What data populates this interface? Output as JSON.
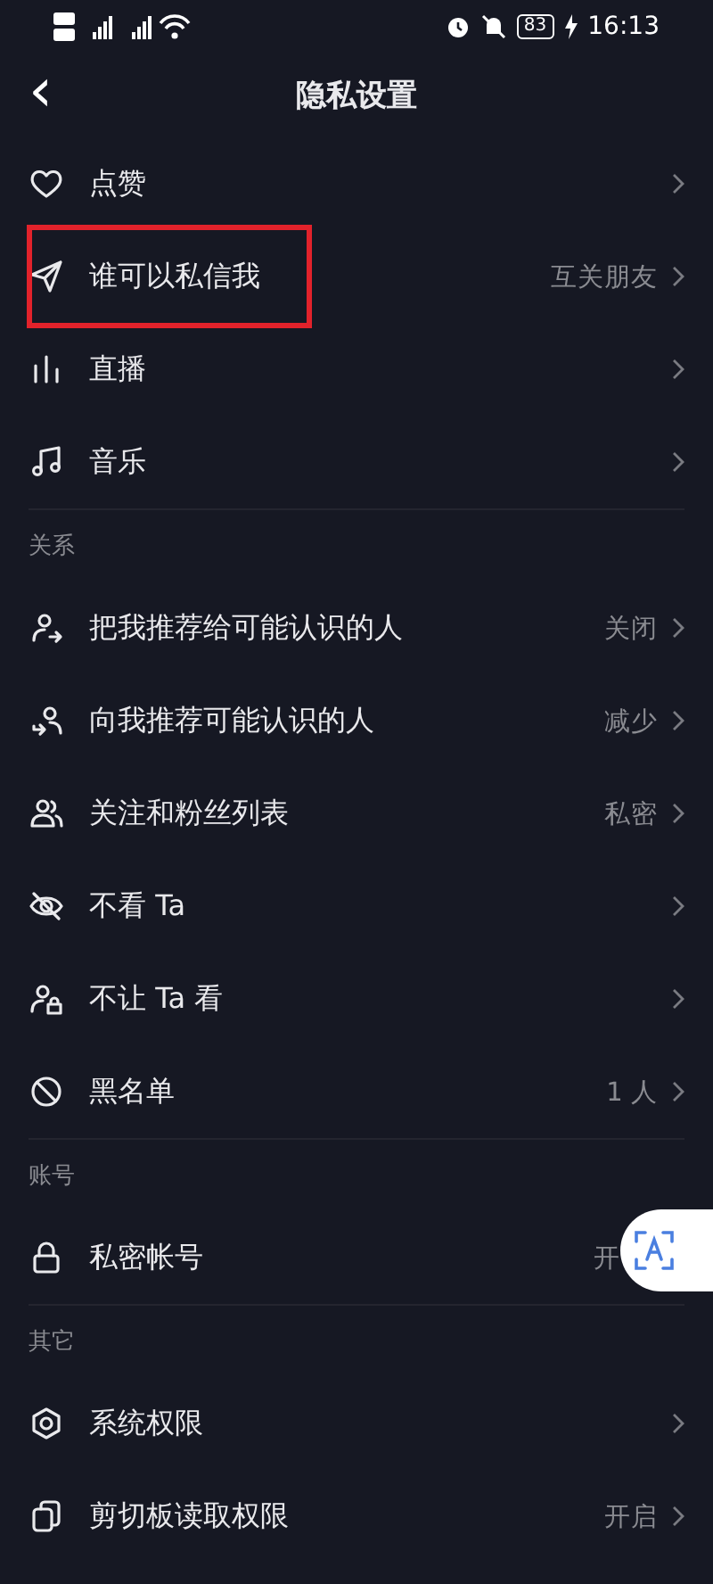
{
  "status_bar": {
    "time": "16:13",
    "battery": "83"
  },
  "header": {
    "back": "‹",
    "title": "隐私设置"
  },
  "sections": [
    {
      "items": [
        {
          "label": "点赞",
          "highlighted": false
        },
        {
          "label": "谁可以私信我",
          "value": "互关朋友",
          "highlighted": true
        },
        {
          "label": "直播",
          "highlighted": false
        },
        {
          "label": "音乐",
          "highlighted": false
        }
      ]
    },
    {
      "title": "关系",
      "items": [
        {
          "label": "把我推荐给可能认识的人",
          "value": "关闭",
          "highlighted": false
        },
        {
          "label": "向我推荐可能认识的人",
          "value": "减少",
          "highlighted": false
        },
        {
          "label": "关注和粉丝列表",
          "value": "私密",
          "highlighted": false
        },
        {
          "label": "不看 Ta",
          "highlighted": false
        },
        {
          "label": "不让 Ta 看",
          "highlighted": false
        },
        {
          "label": "黑名单",
          "value": "1 人",
          "highlighted": false
        }
      ]
    },
    {
      "title": "账号",
      "items": [
        {
          "label": "私密帐号",
          "value": "开",
          "highlighted": false,
          "chevron": false
        }
      ]
    },
    {
      "title": "其它",
      "items": [
        {
          "label": "系统权限",
          "highlighted": false
        },
        {
          "label": "剪切板读取权限",
          "value": "开启",
          "highlighted": false
        }
      ]
    }
  ]
}
